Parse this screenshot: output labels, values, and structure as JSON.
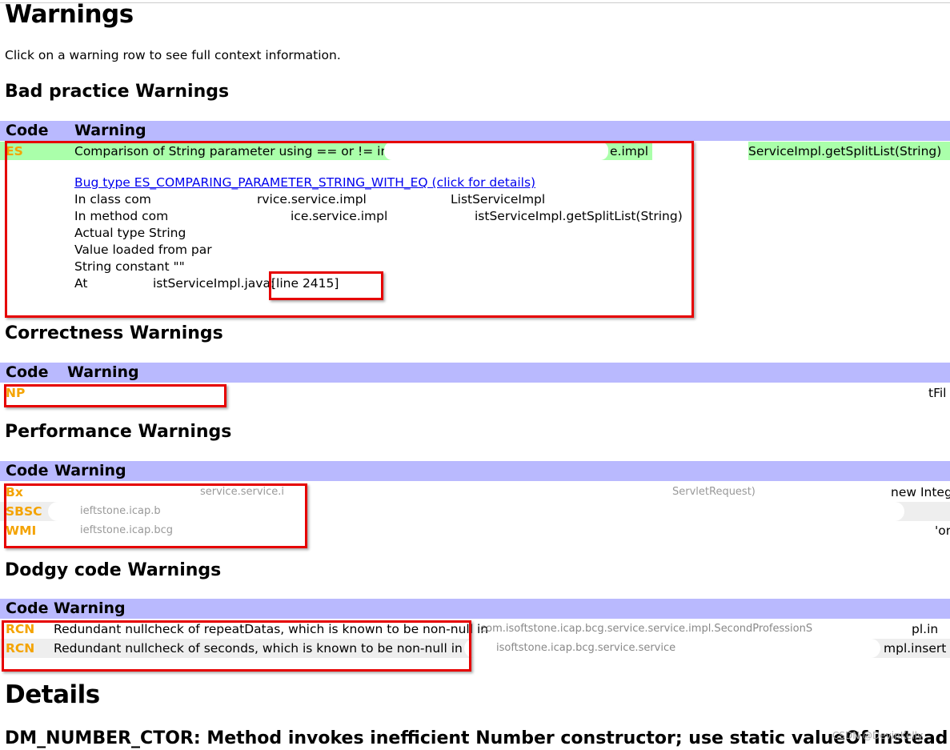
{
  "page_title": "Warnings",
  "intro": "Click on a warning row to see full context information.",
  "columns": {
    "code": "Code",
    "warning": "Warning"
  },
  "bad_practice": {
    "heading": "Bad practice Warnings",
    "row": {
      "code": "ES",
      "text_a": "Comparison of String parameter using == or != in",
      "text_b": "e.impl",
      "text_c": "ServiceImpl.getSplitList(String)"
    },
    "details": {
      "bug_link": "Bug type ES_COMPARING_PARAMETER_STRING_WITH_EQ (click for details)",
      "class_a": "In class com",
      "class_b": "rvice.service.impl",
      "class_c": "ListServiceImpl",
      "method_a": "In method com",
      "method_b": "ice.service.impl",
      "method_c": "istServiceImpl.getSplitList(String)",
      "actual_type": "Actual type String",
      "value_loaded": "Value loaded from par",
      "string_constant": "String constant \"\"",
      "at_a": "At",
      "at_b": "istServiceImpl.java:",
      "at_line": "[line 2415]"
    }
  },
  "correctness": {
    "heading": "Correctness Warnings",
    "row": {
      "code": "NP",
      "tail": "tFil"
    }
  },
  "performance": {
    "heading": "Performance Warnings",
    "rows": [
      {
        "code": "Bx",
        "frag_a": "service.service.i",
        "frag_b": "ServletRequest)",
        "tail": "new Integ"
      },
      {
        "code": "SBSC",
        "frag_a": "ieftstone.icap.b",
        "tail": ""
      },
      {
        "code": "WMI",
        "frag_a": "ieftstone.icap.bcg",
        "tail": "'or"
      }
    ]
  },
  "dodgy": {
    "heading": "Dodgy code Warnings",
    "rows": [
      {
        "code": "RCN",
        "text": "Redundant nullcheck of repeatDatas, which is known to be non-null in",
        "frag": "com.isoftstone.icap.bcg.service.service.impl.SecondProfessionS",
        "tail": "pl.in"
      },
      {
        "code": "RCN",
        "text": "Redundant nullcheck of seconds, which is known to be non-null in",
        "frag": "isoftstone.icap.bcg.service.service",
        "tail": "mpl.insert"
      }
    ]
  },
  "details_heading": "Details",
  "dm_heading": "DM_NUMBER_CTOR: Method invokes inefficient Number constructor; use static valueOf instead",
  "watermark": "CSDN @DevinKelly",
  "colors": {
    "header_bg": "#b9b9fe",
    "selected_row": "#aaffaa",
    "code": "#f4a300",
    "annotation": "#e60000",
    "link": "#0000ee"
  }
}
